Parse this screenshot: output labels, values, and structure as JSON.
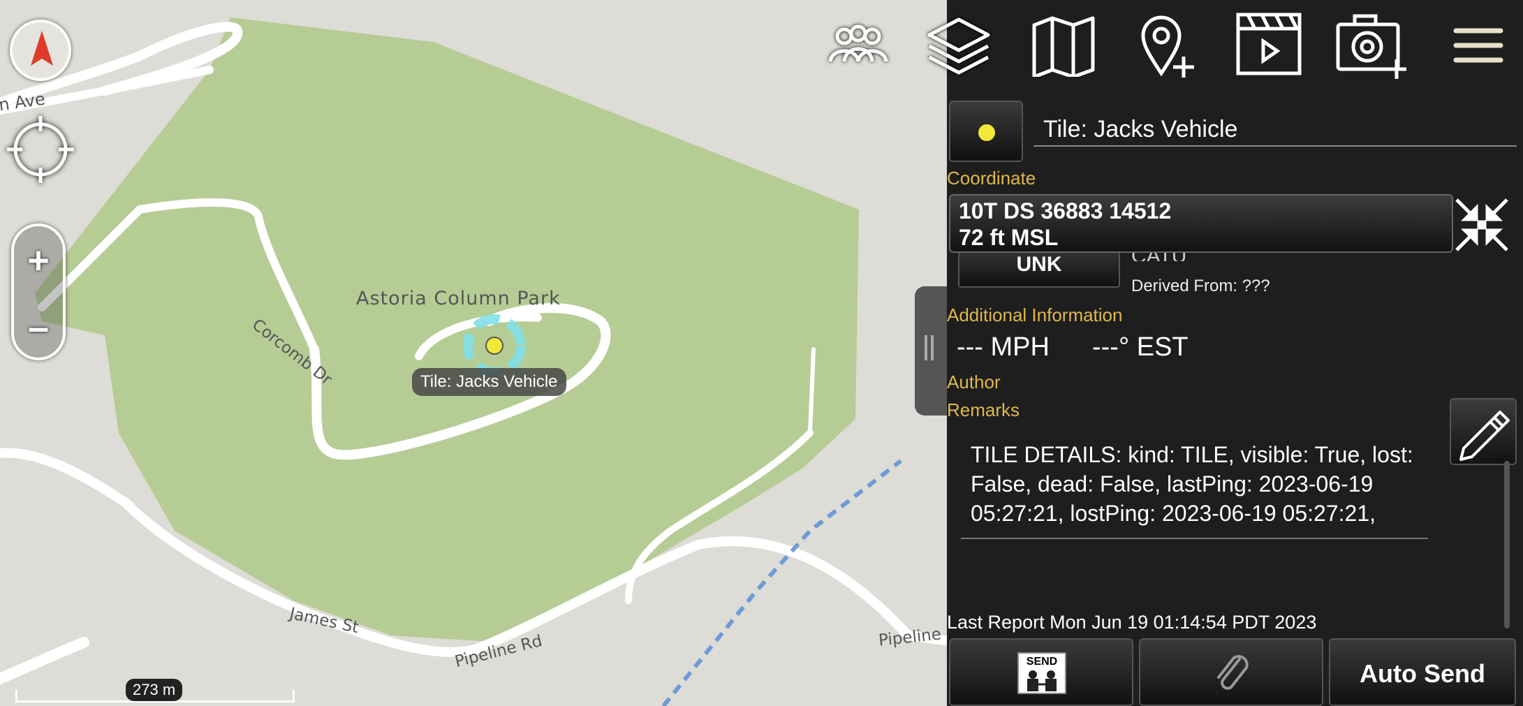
{
  "map": {
    "street_labels": {
      "ave": "n Ave",
      "corcomb": "Corcomb Dr",
      "james": "James St",
      "pipeline_rd": "Pipeline Rd",
      "pipeline_edge": "Pipeline"
    },
    "park_label": "Astoria Column Park",
    "marker_label": "Tile: Jacks Vehicle",
    "scale_label": "273 m",
    "zoom_in": "+",
    "zoom_out": "–"
  },
  "toolbar": {
    "icons": [
      "contacts-icon",
      "layers-icon",
      "map-icon",
      "add-point-icon",
      "video-icon",
      "add-camera-icon",
      "menu-icon"
    ]
  },
  "detail": {
    "title": "Tile: Jacks Vehicle",
    "coordinate_label": "Coordinate",
    "coordinate_line1": "10T DS 36883 14512",
    "coordinate_line2": "72 ft MSL",
    "affiliation": "UNK",
    "hidden_text": "CATU",
    "derived_from": "Derived From: ???",
    "additional_info_label": "Additional Information",
    "speed": "--- MPH",
    "heading": "---° EST",
    "author_label": "Author",
    "remarks_label": "Remarks",
    "remarks_text": "TILE DETAILS: kind: TILE, visible: True, lost: False, dead: False, lastPing: 2023-06-19 05:27:21, lostPing: 2023-06-19 05:27:21,",
    "last_report": "Last Report Mon Jun 19 01:14:54 PDT 2023",
    "auto_send": "Auto Send",
    "send_icon_text": "SEND"
  },
  "colors": {
    "panel_bg": "#1e1e1e",
    "gold_label": "#e0b84a",
    "park_green": "#b5cc95",
    "marker_yellow": "#f2e83a",
    "marker_ring": "#7fe0e8"
  }
}
